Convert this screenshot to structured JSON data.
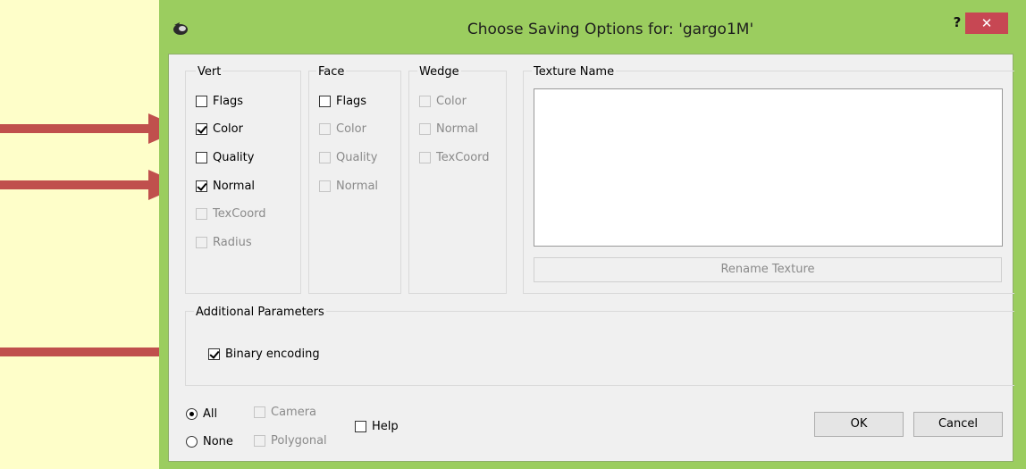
{
  "dialog": {
    "title": "Choose Saving Options for: 'gargo1M'",
    "help_label": "?",
    "close_label": "✕",
    "title_bar_color": "#9bcd5f",
    "close_color": "#c74753"
  },
  "vert": {
    "label": "Vert",
    "items": [
      {
        "label": "Flags",
        "checked": false,
        "enabled": true
      },
      {
        "label": "Color",
        "checked": true,
        "enabled": true
      },
      {
        "label": "Quality",
        "checked": false,
        "enabled": true
      },
      {
        "label": "Normal",
        "checked": true,
        "enabled": true
      },
      {
        "label": "TexCoord",
        "checked": false,
        "enabled": false
      },
      {
        "label": "Radius",
        "checked": false,
        "enabled": false
      }
    ]
  },
  "face": {
    "label": "Face",
    "items": [
      {
        "label": "Flags",
        "checked": false,
        "enabled": true
      },
      {
        "label": "Color",
        "checked": false,
        "enabled": false
      },
      {
        "label": "Quality",
        "checked": false,
        "enabled": false
      },
      {
        "label": "Normal",
        "checked": false,
        "enabled": false
      }
    ]
  },
  "wedge": {
    "label": "Wedge",
    "items": [
      {
        "label": "Color",
        "checked": false,
        "enabled": false
      },
      {
        "label": "Normal",
        "checked": false,
        "enabled": false
      },
      {
        "label": "TexCoord",
        "checked": false,
        "enabled": false
      }
    ]
  },
  "texture": {
    "label": "Texture Name",
    "rename_label": "Rename Texture"
  },
  "additional": {
    "label": "Additional Parameters",
    "binary_label": "Binary encoding",
    "binary_checked": true
  },
  "bottom": {
    "all_label": "All",
    "none_label": "None",
    "camera_label": "Camera",
    "polygonal_label": "Polygonal",
    "help_label": "Help",
    "ok_label": "OK",
    "cancel_label": "Cancel"
  },
  "annotation": {
    "arrow_color": "#c0504d"
  }
}
